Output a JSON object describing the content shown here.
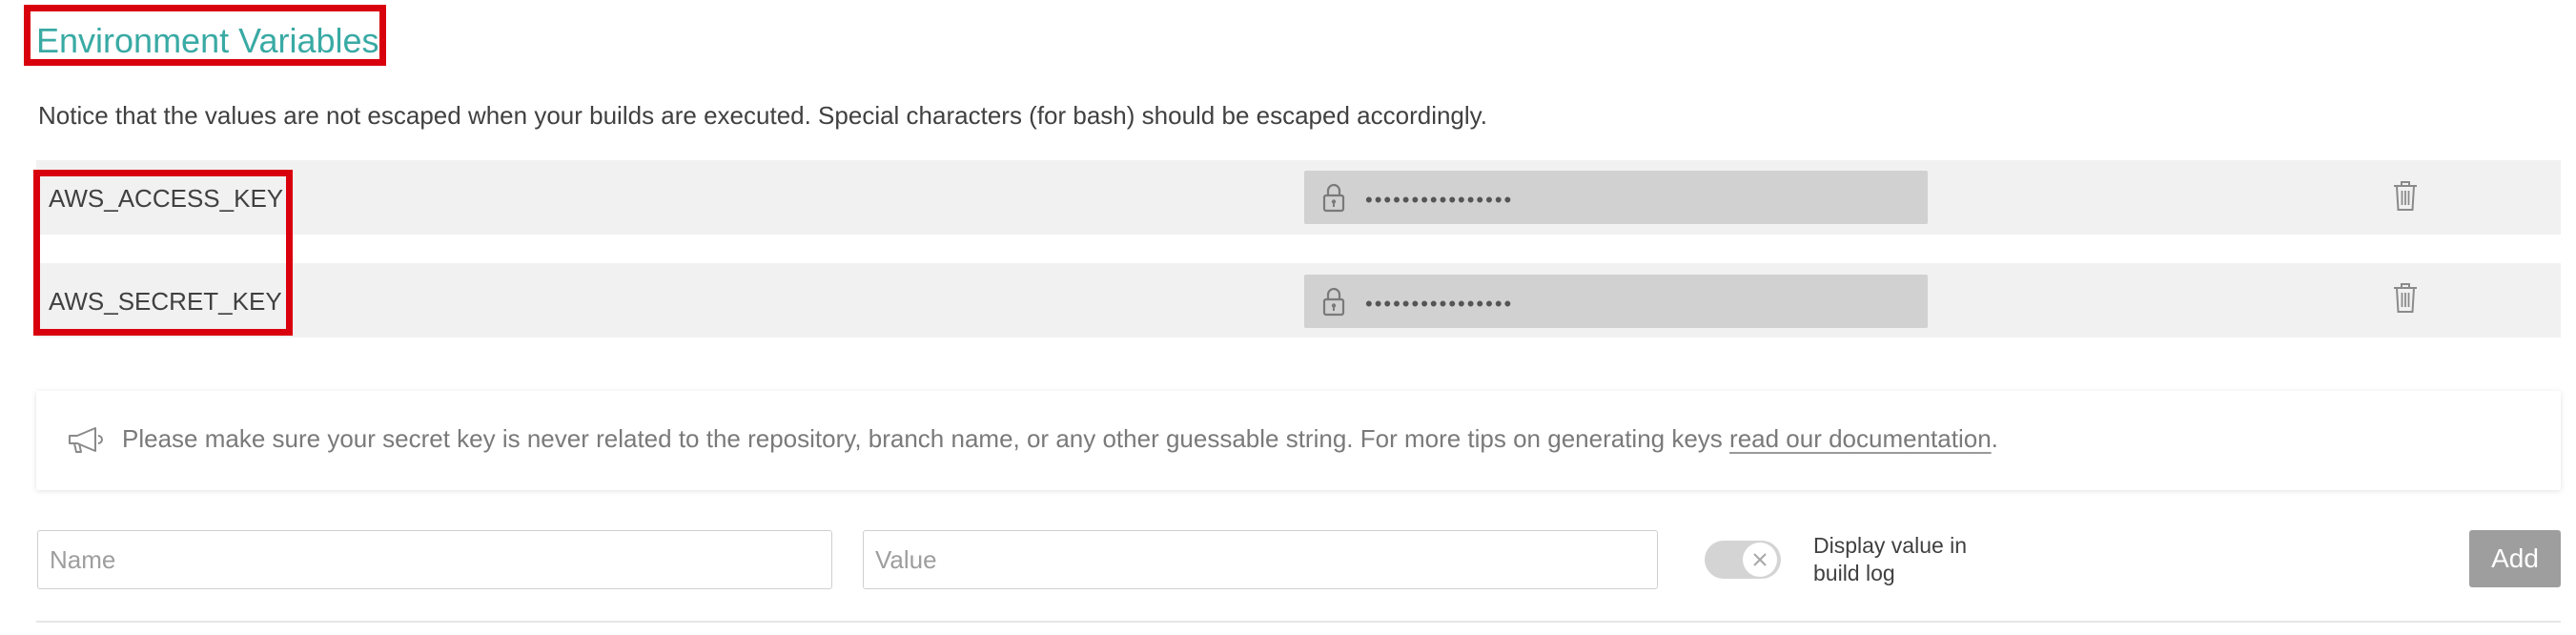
{
  "page": {
    "title": "Environment Variables",
    "notice": "Notice that the values are not escaped when your builds are executed. Special characters (for bash) should be escaped accordingly."
  },
  "variables": [
    {
      "name": "AWS_ACCESS_KEY",
      "masked_value": "••••••••••••••••",
      "icon": "lock-icon",
      "delete_icon": "trash-icon"
    },
    {
      "name": "AWS_SECRET_KEY",
      "masked_value": "••••••••••••••••",
      "icon": "lock-icon",
      "delete_icon": "trash-icon"
    }
  ],
  "tip": {
    "icon": "megaphone-icon",
    "text": "Please make sure your secret key is never related to the repository, branch name, or any other guessable string. For more tips on generating keys ",
    "link_text": "read our documentation",
    "suffix": "."
  },
  "form": {
    "name_placeholder": "Name",
    "value_placeholder": "Value",
    "toggle_label": "Display value in build log",
    "toggle_on": false,
    "add_label": "Add"
  },
  "colors": {
    "title": "#39aaa4",
    "annotation_border": "#d9000d",
    "row_background": "#f1f1f1",
    "secret_box": "#d1d1d1",
    "add_button": "#9e9e9e"
  }
}
